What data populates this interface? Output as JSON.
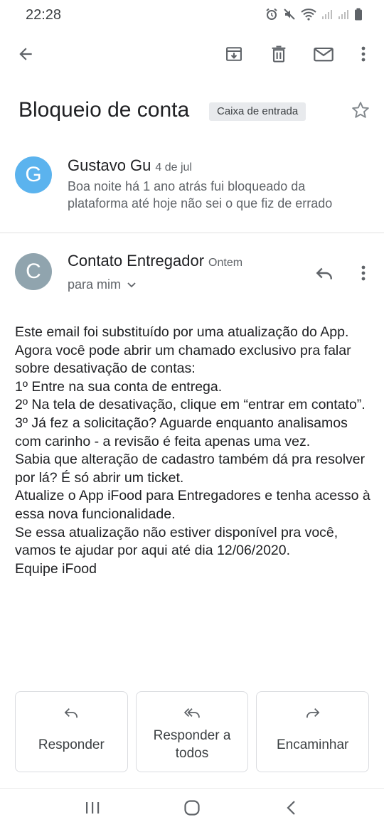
{
  "status_bar": {
    "time": "22:28",
    "icons": [
      "alarm-icon",
      "mute-icon",
      "wifi-icon",
      "signal-icon",
      "signal-icon-2",
      "battery-icon"
    ]
  },
  "toolbar": {
    "icons": [
      "back-arrow-icon",
      "archive-icon",
      "delete-icon",
      "mark-unread-icon",
      "more-vert-icon"
    ]
  },
  "email": {
    "subject": "Bloqueio de conta",
    "label": "Caixa de entrada"
  },
  "messages": [
    {
      "avatar_letter": "G",
      "avatar_color": "#5bb3ee",
      "sender": "Gustavo Gu",
      "date": "4 de jul",
      "snippet": "Boa noite há 1 ano atrás fui bloqueado da plataforma até hoje não sei o que fiz de errado"
    },
    {
      "avatar_letter": "C",
      "avatar_color": "#90a4ae",
      "sender": "Contato Entregador",
      "date": "Ontem",
      "recipient": "para mim",
      "body": [
        "Este email foi substituído por uma atualização do App. Agora você pode abrir um chamado exclusivo pra falar sobre desativação de contas:",
        "1º Entre na sua conta de entrega.",
        "2º Na tela de desativação, clique em “entrar em contato”.",
        "3º Já fez a solicitação? Aguarde enquanto analisamos com carinho - a revisão é feita apenas uma vez.",
        "Sabia que alteração de cadastro também dá pra resolver por lá? É só abrir um ticket.",
        "Atualize o App iFood para Entregadores e tenha acesso à essa nova funcionalidade.",
        "Se essa atualização não estiver disponível pra você, vamos te ajudar por aqui até dia 12/06/2020.",
        "Equipe iFood"
      ]
    }
  ],
  "actions": {
    "reply": "Responder",
    "reply_all": "Responder a todos",
    "forward": "Encaminhar"
  },
  "colors": {
    "text_primary": "#202124",
    "text_secondary": "#5f6368",
    "icon": "#5f6368",
    "chip_bg": "#e8eaed"
  }
}
